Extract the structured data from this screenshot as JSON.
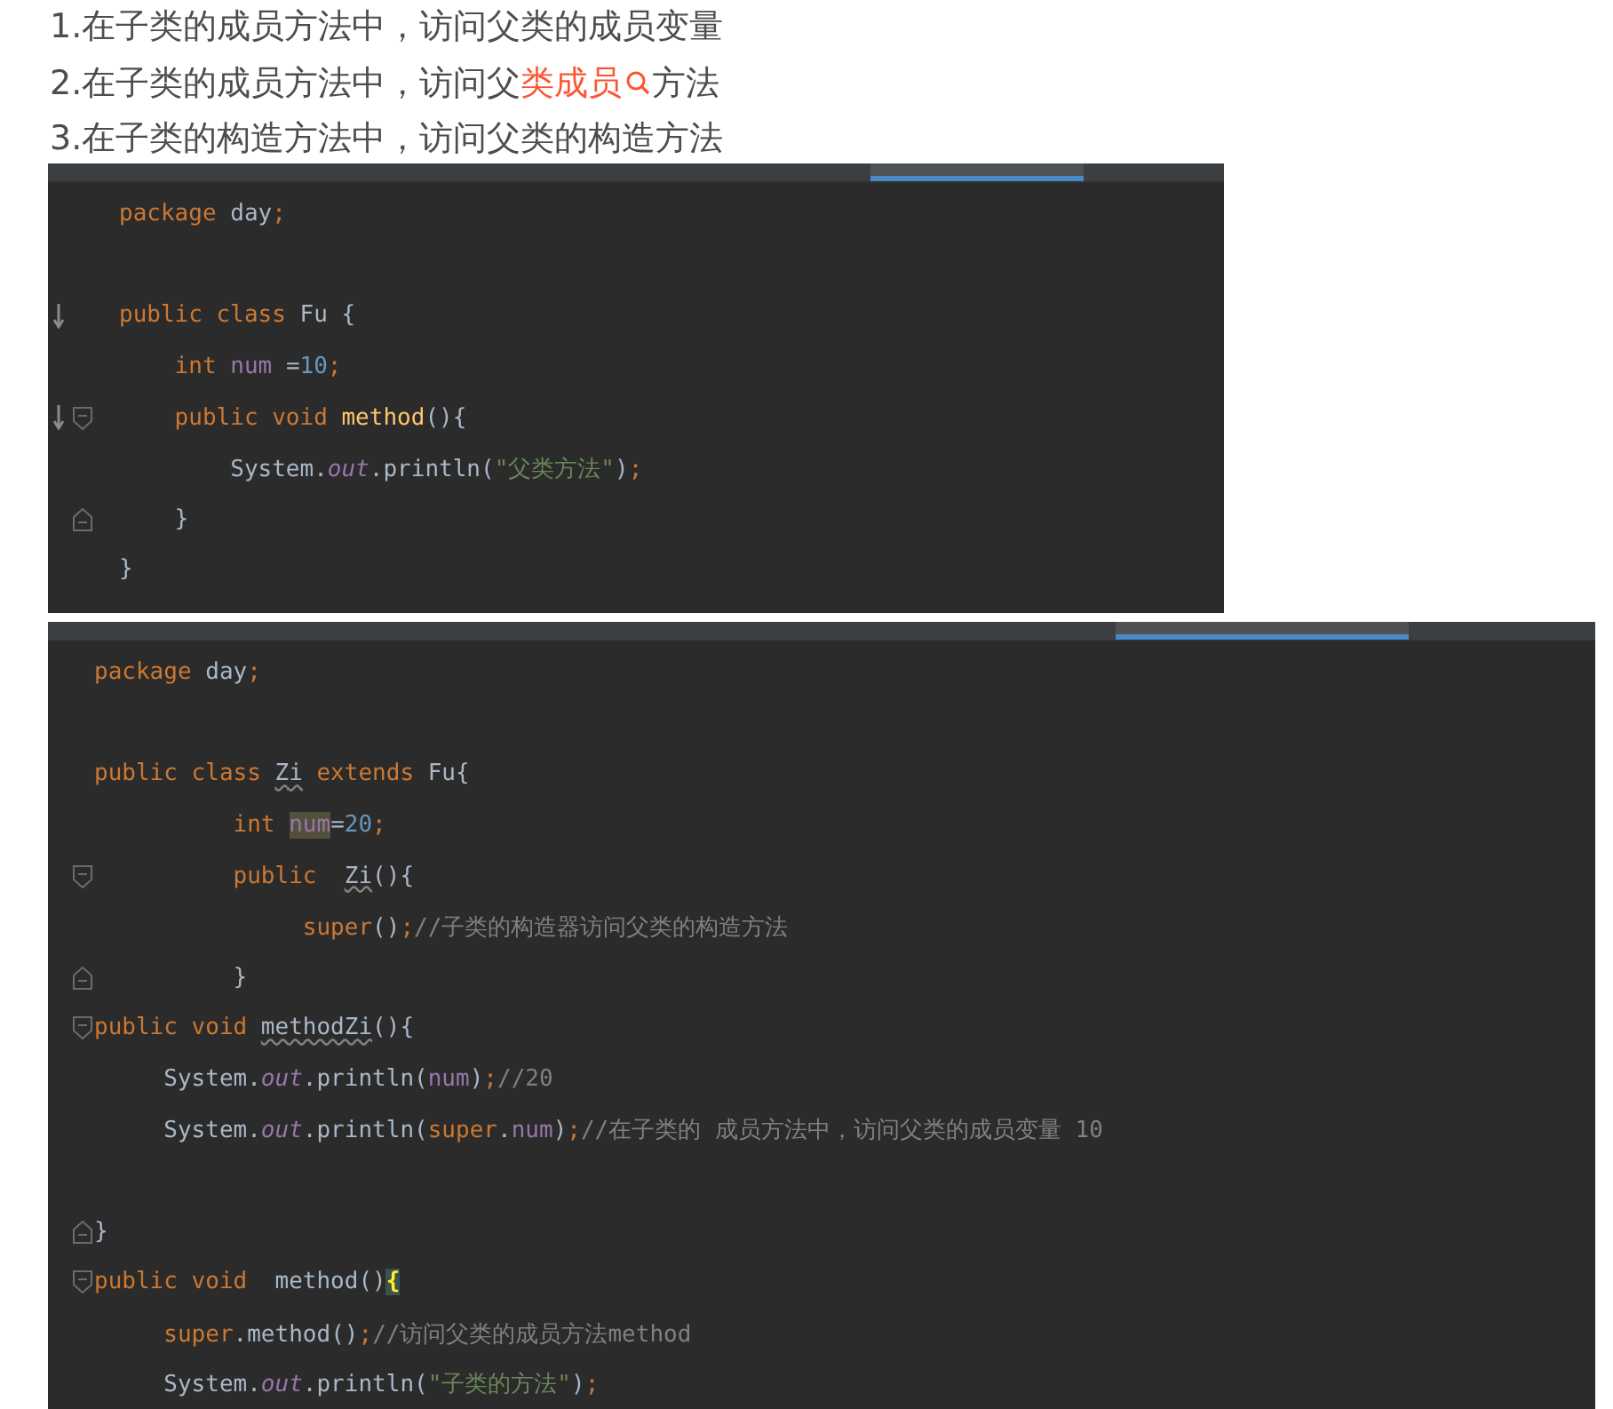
{
  "list_items": [
    {
      "parts": [
        {
          "kind": "text",
          "text": "1.在子类的成员方法中，访问父类的成员变量"
        }
      ]
    },
    {
      "parts": [
        {
          "kind": "text",
          "text": "2.在子类的成员方法中，访问父"
        },
        {
          "kind": "link",
          "text": "类成员"
        },
        {
          "kind": "text",
          "text": "方法"
        }
      ]
    },
    {
      "parts": [
        {
          "kind": "text",
          "text": "3.在子类的构造方法中，访问父类的构造方法"
        }
      ]
    }
  ],
  "code_blocks": [
    {
      "kind": "narrow",
      "lines": [
        {
          "kind": "plain",
          "tokens": [
            {
              "kind": "keyword",
              "text": "package "
            },
            {
              "kind": "plain",
              "text": "day"
            },
            {
              "kind": "keyword",
              "text": ";"
            }
          ]
        },
        {
          "kind": "blank"
        },
        {
          "kind": "override",
          "tokens": [
            {
              "kind": "keyword",
              "text": "public class "
            },
            {
              "kind": "plain",
              "text": "Fu {"
            }
          ]
        },
        {
          "kind": "plain",
          "tokens": [
            {
              "kind": "keyword",
              "text": "    int "
            },
            {
              "kind": "field",
              "text": "num "
            },
            {
              "kind": "plain",
              "text": "="
            },
            {
              "kind": "number",
              "text": "10"
            },
            {
              "kind": "keyword",
              "text": ";"
            }
          ]
        },
        {
          "kind": "overridefold",
          "tokens": [
            {
              "kind": "keyword",
              "text": "    public void "
            },
            {
              "kind": "method",
              "text": "method"
            },
            {
              "kind": "plain",
              "text": "(){"
            }
          ]
        },
        {
          "kind": "plain",
          "tokens": [
            {
              "kind": "plain",
              "text": "        System."
            },
            {
              "kind": "static",
              "text": "out"
            },
            {
              "kind": "plain",
              "text": ".println("
            },
            {
              "kind": "string",
              "text": "\"父类方法\""
            },
            {
              "kind": "plain",
              "text": ")"
            },
            {
              "kind": "keyword",
              "text": ";"
            }
          ]
        },
        {
          "kind": "foldend",
          "tokens": [
            {
              "kind": "plain",
              "text": "    }"
            }
          ]
        },
        {
          "kind": "plain",
          "tokens": [
            {
              "kind": "plain",
              "text": "}"
            }
          ]
        }
      ]
    },
    {
      "kind": "wide",
      "lines": [
        {
          "kind": "plain",
          "tokens": [
            {
              "kind": "keyword",
              "text": "package "
            },
            {
              "kind": "plain",
              "text": "day"
            },
            {
              "kind": "keyword",
              "text": ";"
            }
          ]
        },
        {
          "kind": "blank"
        },
        {
          "kind": "plain",
          "tokens": [
            {
              "kind": "keyword",
              "text": "public class "
            },
            {
              "kind": "warn",
              "text": "Zi"
            },
            {
              "kind": "keyword",
              "text": " extends "
            },
            {
              "kind": "plain",
              "text": "Fu{"
            }
          ]
        },
        {
          "kind": "plain",
          "tokens": [
            {
              "kind": "keyword",
              "text": "          int "
            },
            {
              "kind": "highlight",
              "text": "num"
            },
            {
              "kind": "plain",
              "text": "="
            },
            {
              "kind": "number",
              "text": "20"
            },
            {
              "kind": "keyword",
              "text": ";"
            }
          ]
        },
        {
          "kind": "foldstart",
          "tokens": [
            {
              "kind": "keyword",
              "text": "          public  "
            },
            {
              "kind": "warn",
              "text": "Zi"
            },
            {
              "kind": "plain",
              "text": "(){"
            }
          ]
        },
        {
          "kind": "plain",
          "tokens": [
            {
              "kind": "keyword",
              "text": "               super"
            },
            {
              "kind": "plain",
              "text": "()"
            },
            {
              "kind": "keyword",
              "text": ";"
            },
            {
              "kind": "comment",
              "text": "//子类的构造器访问父类的构造方法"
            }
          ]
        },
        {
          "kind": "foldend",
          "tokens": [
            {
              "kind": "plain",
              "text": "          }"
            }
          ]
        },
        {
          "kind": "foldstart",
          "tokens": [
            {
              "kind": "keyword",
              "text": "public void "
            },
            {
              "kind": "warn",
              "text": "methodZi"
            },
            {
              "kind": "plain",
              "text": "(){"
            }
          ]
        },
        {
          "kind": "plain",
          "tokens": [
            {
              "kind": "plain",
              "text": "     System."
            },
            {
              "kind": "static",
              "text": "out"
            },
            {
              "kind": "plain",
              "text": ".println("
            },
            {
              "kind": "field",
              "text": "num"
            },
            {
              "kind": "plain",
              "text": ")"
            },
            {
              "kind": "keyword",
              "text": ";"
            },
            {
              "kind": "comment",
              "text": "//20"
            }
          ]
        },
        {
          "kind": "plain",
          "tokens": [
            {
              "kind": "plain",
              "text": "     System."
            },
            {
              "kind": "static",
              "text": "out"
            },
            {
              "kind": "plain",
              "text": ".println("
            },
            {
              "kind": "keyword",
              "text": "super"
            },
            {
              "kind": "plain",
              "text": "."
            },
            {
              "kind": "field",
              "text": "num"
            },
            {
              "kind": "plain",
              "text": ")"
            },
            {
              "kind": "keyword",
              "text": ";"
            },
            {
              "kind": "comment",
              "text": "//在子类的 成员方法中，访问父类的成员变量 10"
            }
          ]
        },
        {
          "kind": "blank"
        },
        {
          "kind": "foldend",
          "tokens": [
            {
              "kind": "plain",
              "text": "}"
            }
          ]
        },
        {
          "kind": "foldstart",
          "tokens": [
            {
              "kind": "keyword",
              "text": "public void  "
            },
            {
              "kind": "plain",
              "text": "method()"
            },
            {
              "kind": "brace",
              "text": "{"
            }
          ]
        },
        {
          "kind": "plain",
          "tokens": [
            {
              "kind": "keyword",
              "text": "     super"
            },
            {
              "kind": "plain",
              "text": ".method()"
            },
            {
              "kind": "keyword",
              "text": ";"
            },
            {
              "kind": "comment",
              "text": "//访问父类的成员方法method"
            }
          ]
        },
        {
          "kind": "plain",
          "tokens": [
            {
              "kind": "plain",
              "text": "     System."
            },
            {
              "kind": "static",
              "text": "out"
            },
            {
              "kind": "plain",
              "text": ".println("
            },
            {
              "kind": "string",
              "text": "\"子类的方法\""
            },
            {
              "kind": "plain",
              "text": ")"
            },
            {
              "kind": "keyword",
              "text": ";"
            }
          ]
        }
      ]
    }
  ]
}
